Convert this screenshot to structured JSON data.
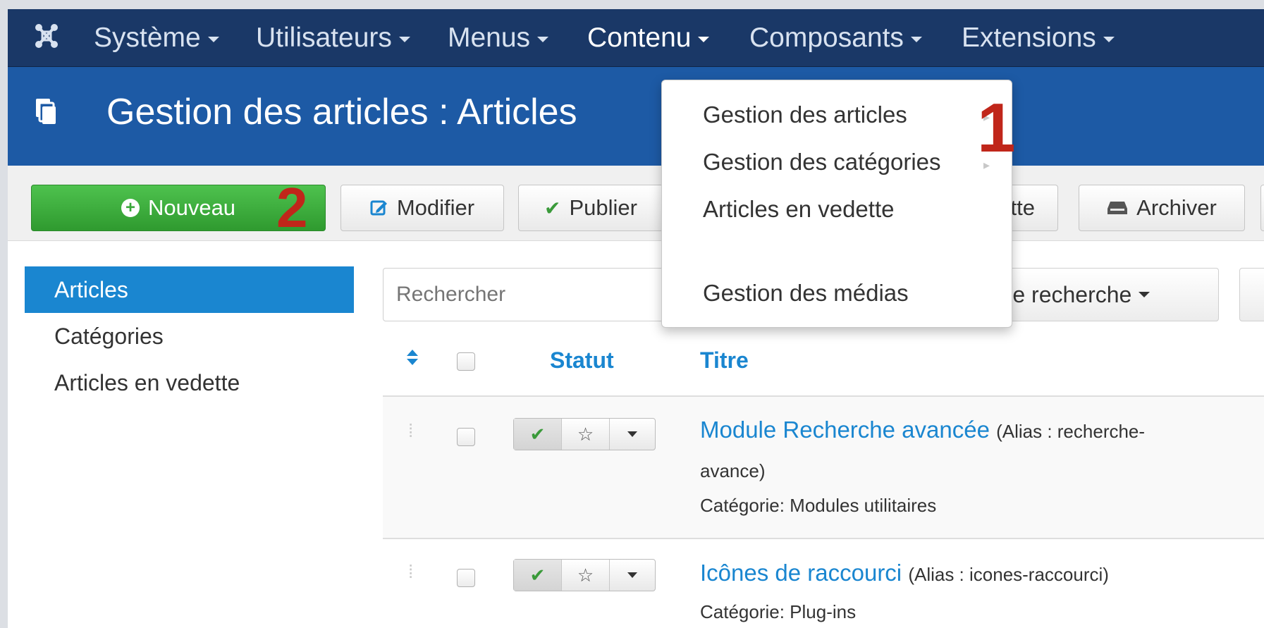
{
  "navbar": {
    "items": [
      {
        "label": "Système"
      },
      {
        "label": "Utilisateurs"
      },
      {
        "label": "Menus"
      },
      {
        "label": "Contenu"
      },
      {
        "label": "Composants"
      },
      {
        "label": "Extensions"
      }
    ],
    "active": "Contenu",
    "logo_icon": "joomla-logo-icon"
  },
  "header": {
    "title": "Gestion des articles : Articles",
    "icon": "stack-icon"
  },
  "toolbar": {
    "new_label": "Nouveau",
    "edit_label": "Modifier",
    "publish_label": "Publier",
    "featured_partial_label": "ette",
    "archive_label": "Archiver"
  },
  "annotations": {
    "step1": "1",
    "step2": "2"
  },
  "sidebar": {
    "items": [
      {
        "label": "Articles"
      },
      {
        "label": "Catégories"
      },
      {
        "label": "Articles en vedette"
      }
    ],
    "active": "Articles"
  },
  "search": {
    "placeholder": "Rechercher",
    "tools_label": "s de recherche"
  },
  "table": {
    "headers": {
      "status": "Statut",
      "title": "Titre"
    },
    "rows": [
      {
        "title": "Module Recherche avancée",
        "alias_text": "(Alias : recherche-",
        "alias_cont": "avance)",
        "category": "Catégorie: Modules utilitaires"
      },
      {
        "title": "Icônes de raccourci",
        "alias_text": "(Alias : icones-raccourci)",
        "category": "Catégorie: Plug-ins"
      }
    ]
  },
  "dropdown": {
    "items": [
      {
        "label": "Gestion des articles"
      },
      {
        "label": "Gestion des catégories"
      },
      {
        "label": "Articles en vedette"
      },
      {
        "label": "Gestion des médias"
      }
    ]
  },
  "colors": {
    "navbar": "#1a3867",
    "header": "#1d5aa5",
    "accent": "#1a86d0",
    "new_button": "#3aa83a",
    "annotation": "#c0261a"
  }
}
